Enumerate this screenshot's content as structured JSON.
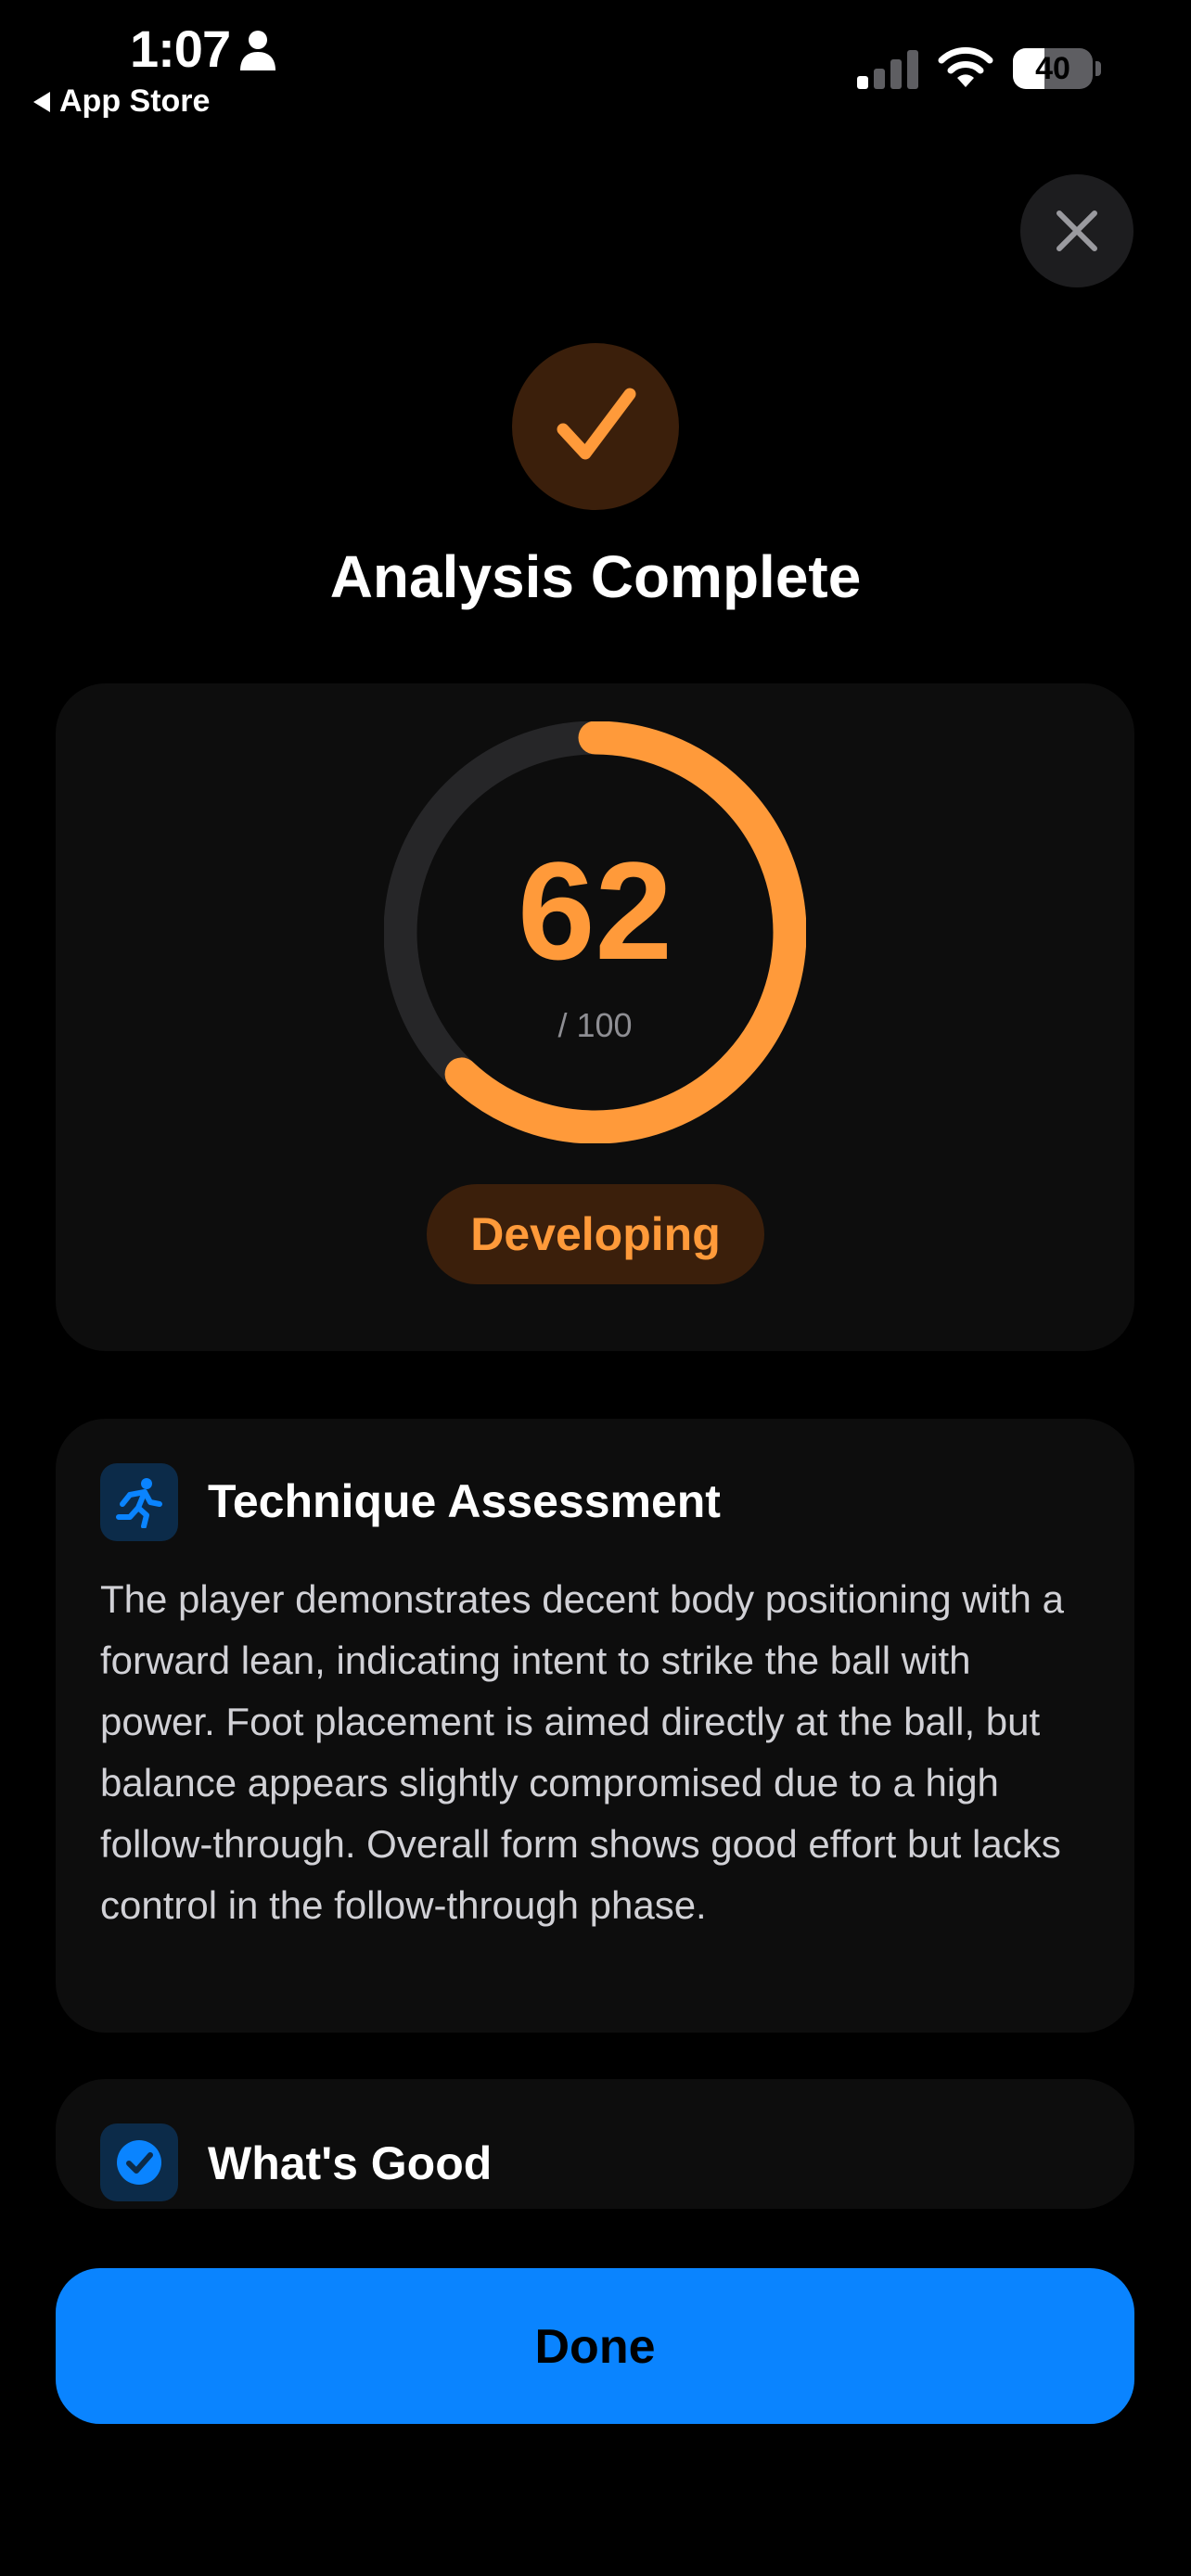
{
  "status_bar": {
    "time": "1:07",
    "back_label": "App Store",
    "battery_level": "40",
    "battery_percent": 40
  },
  "header": {
    "title": "Analysis Complete",
    "close_icon": "close-icon",
    "success_icon": "checkmark-icon"
  },
  "score": {
    "value": "62",
    "max_label": "/ 100",
    "fraction": 0.62,
    "level": "Developing"
  },
  "technique": {
    "title": "Technique Assessment",
    "icon": "running-figure-icon",
    "body": "The player demonstrates decent body positioning with a forward lean, indicating intent to strike the ball with power. Foot placement is aimed directly at the ball, but balance appears slightly compromised due to a high follow-through. Overall form shows good effort but lacks control in the follow-through phase."
  },
  "whats_good": {
    "title": "What's Good",
    "icon": "checkmark-seal-icon"
  },
  "actions": {
    "done_label": "Done"
  },
  "colors": {
    "accent_orange": "#ff9a3a",
    "primary_blue": "#0a84ff",
    "card_bg": "#0d0d0d"
  }
}
